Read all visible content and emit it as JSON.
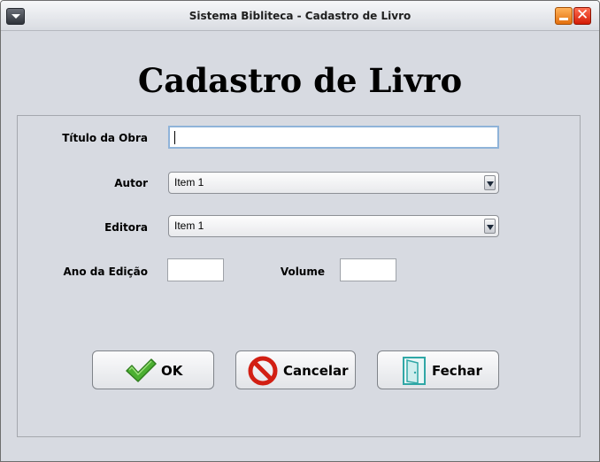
{
  "window": {
    "title": "Sistema Bibliteca - Cadastro de Livro",
    "controls": [
      "minimize-icon",
      "close-icon"
    ]
  },
  "form": {
    "heading": "Cadastro de Livro",
    "titulo": {
      "label": "Título da Obra",
      "value": ""
    },
    "autor": {
      "label": "Autor",
      "selected": "Item 1"
    },
    "editora": {
      "label": "Editora",
      "selected": "Item 1"
    },
    "ano": {
      "label": "Ano da Edição",
      "value": ""
    },
    "volume": {
      "label": "Volume",
      "value": ""
    }
  },
  "buttons": {
    "ok": {
      "label": "OK",
      "icon": "checkmark-icon"
    },
    "cancelar": {
      "label": "Cancelar",
      "icon": "no-entry-icon"
    },
    "fechar": {
      "label": "Fechar",
      "icon": "door-icon"
    }
  },
  "colors": {
    "window_bg": "#d7dae1",
    "ok_icon": "#4caf32",
    "cancel_icon": "#d21f13",
    "door_icon": "#2fa7a6"
  }
}
